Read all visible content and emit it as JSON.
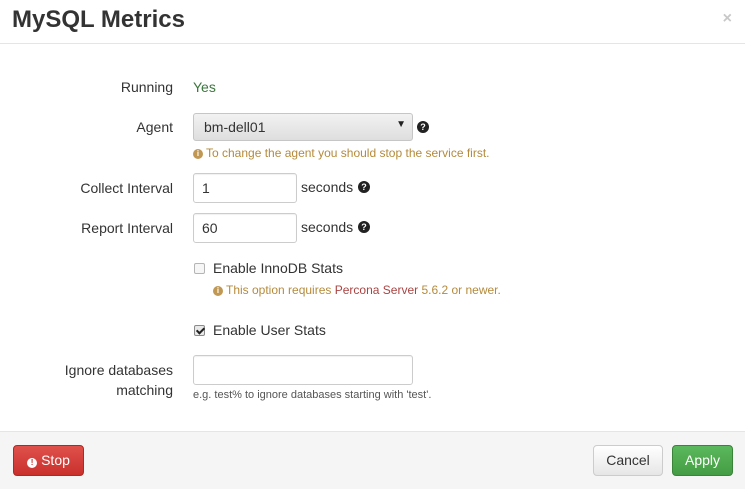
{
  "modal": {
    "title": "MySQL Metrics",
    "close_glyph": "×"
  },
  "fields": {
    "running": {
      "label": "Running",
      "value": "Yes"
    },
    "agent": {
      "label": "Agent",
      "selected": "bm-dell01",
      "help_icon": "question-circle-icon",
      "notice": "To change the agent you should stop the service first."
    },
    "collect_interval": {
      "label": "Collect Interval",
      "value": "1",
      "unit": "seconds"
    },
    "report_interval": {
      "label": "Report Interval",
      "value": "60",
      "unit": "seconds"
    },
    "innodb_stats": {
      "label": "Enable InnoDB Stats",
      "checked": false,
      "notice_prefix": "This option requires",
      "notice_link": "Percona Server",
      "notice_suffix": "5.6.2 or newer."
    },
    "user_stats": {
      "label": "Enable User Stats",
      "checked": true
    },
    "ignore_databases": {
      "label_line1": "Ignore databases",
      "label_line2": "matching",
      "value": "",
      "help": "e.g. test% to ignore databases starting with 'test'."
    }
  },
  "footer": {
    "stop_label": "Stop",
    "cancel_label": "Cancel",
    "apply_label": "Apply"
  },
  "colors": {
    "running_value": "#3c763d",
    "warning_text": "#b58a3b",
    "link_text": "#a94442",
    "stop_button": "#d9534f",
    "apply_button": "#5cb85c"
  }
}
